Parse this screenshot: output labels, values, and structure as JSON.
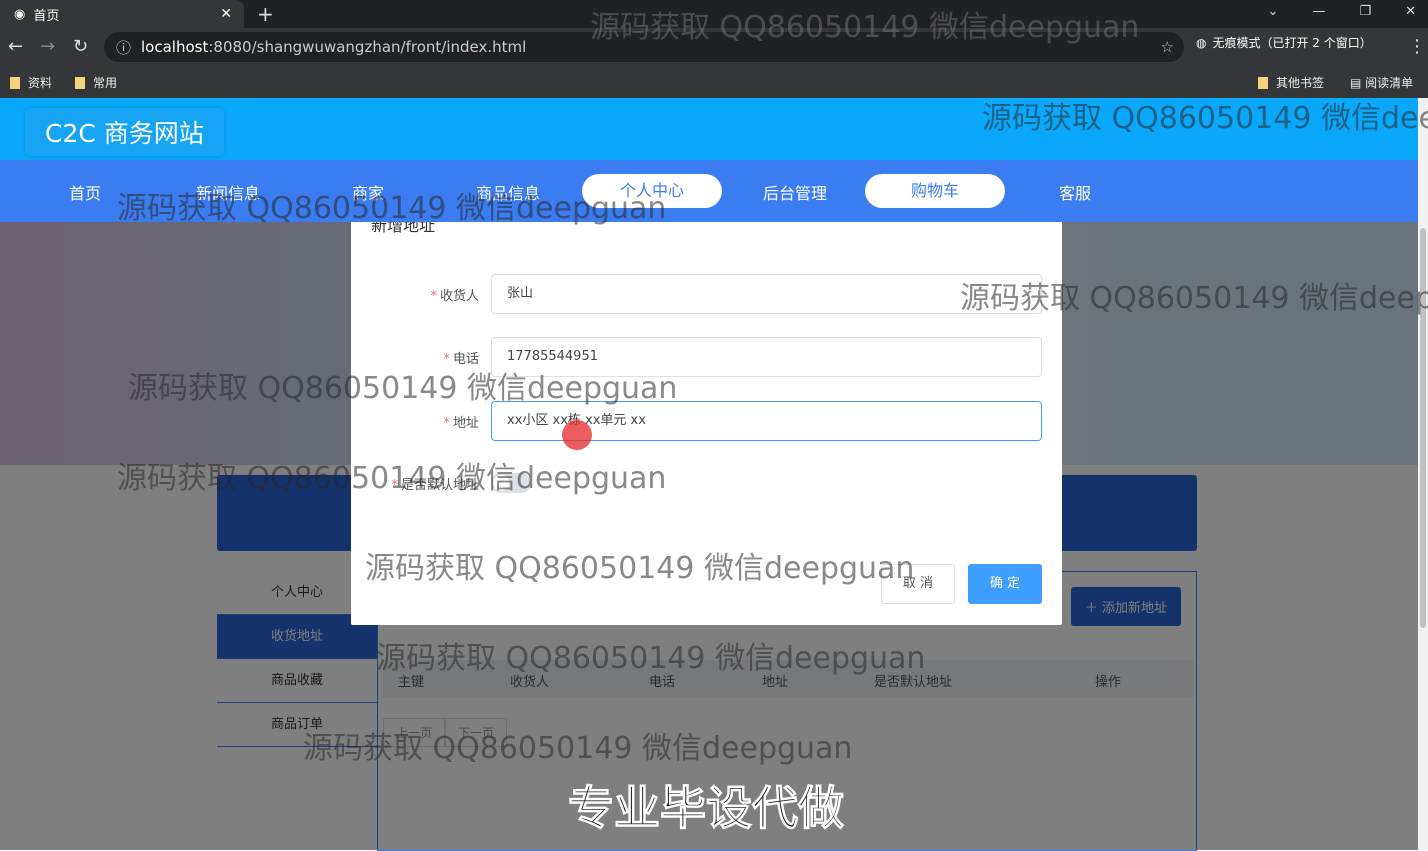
{
  "browser": {
    "tab_title": "首页",
    "url_host": "localhost",
    "url_path": ":8080/shangwuwangzhan/front/index.html",
    "incognito": "无痕模式（已打开 2 个窗口）",
    "bookmarks": [
      "资料",
      "常用"
    ],
    "other_bookmarks": "其他书签",
    "reading_list": "阅读清单"
  },
  "site": {
    "logo": "C2C 商务网站",
    "nav": [
      "首页",
      "新闻信息",
      "商家",
      "商品信息",
      "个人中心",
      "后台管理",
      "购物车",
      "客服"
    ]
  },
  "sidebar": [
    "个人中心",
    "收货地址",
    "商品收藏",
    "商品订单"
  ],
  "panel": {
    "add_button": "添加新地址",
    "columns": [
      "主键",
      "收货人",
      "电话",
      "地址",
      "是否默认地址",
      "操作"
    ],
    "pager": [
      "上一页",
      "下一页"
    ]
  },
  "modal": {
    "title": "新增地址",
    "fields": [
      {
        "label": "收货人",
        "value": "张山"
      },
      {
        "label": "电话",
        "value": "17785544951"
      },
      {
        "label": "地址",
        "value": "xx小区 xx栋 xx单元 xx"
      }
    ],
    "default_label": "是否默认地址",
    "default_on": false,
    "cancel": "取 消",
    "ok": "确 定"
  },
  "watermark": "源码获取 QQ86050149 微信deepguan",
  "banner_text": "专业毕设代做"
}
